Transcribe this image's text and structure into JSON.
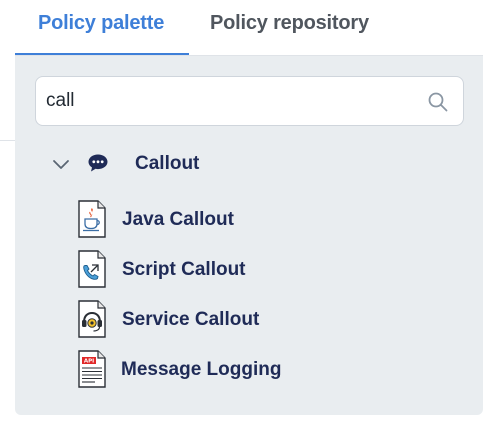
{
  "tabs": [
    {
      "label": "Policy palette",
      "active": true
    },
    {
      "label": "Policy repository",
      "active": false
    }
  ],
  "search": {
    "value": "call",
    "icon": "search-icon"
  },
  "group": {
    "label": "Callout",
    "expanded": true,
    "icon": "chat-bubble-icon"
  },
  "policies": [
    {
      "label": "Java Callout",
      "icon": "java-file-icon"
    },
    {
      "label": "Script Callout",
      "icon": "phone-script-file-icon"
    },
    {
      "label": "Service Callout",
      "icon": "headset-file-icon"
    },
    {
      "label": "Message Logging",
      "icon": "api-log-file-icon"
    }
  ],
  "colors": {
    "accent": "#3e7fd8",
    "text_dark": "#1f2b57",
    "panel_bg": "#e9edf0",
    "inactive_tab": "#50565e"
  }
}
